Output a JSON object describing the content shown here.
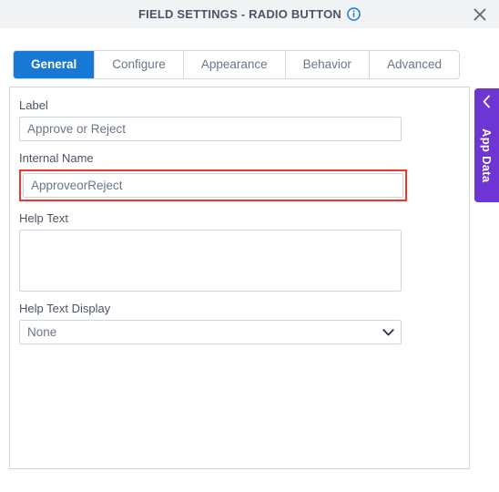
{
  "window": {
    "title": "FIELD SETTINGS - RADIO BUTTON",
    "info_icon": "info-circle-icon",
    "close_icon": "close-icon",
    "header_bg": "#f2f3f5",
    "title_color": "#4b5565"
  },
  "tabs": [
    {
      "label": "General",
      "active": true
    },
    {
      "label": "Configure",
      "active": false
    },
    {
      "label": "Appearance",
      "active": false
    },
    {
      "label": "Behavior",
      "active": false
    },
    {
      "label": "Advanced",
      "active": false
    }
  ],
  "accent": {
    "tab_active_bg": "#1779d3",
    "highlight_border": "#f4372a",
    "app_data_bg": "#6c35d4"
  },
  "form": {
    "label_field": {
      "label": "Label",
      "value": "Approve or Reject",
      "placeholder": ""
    },
    "internal_name_field": {
      "label": "Internal Name",
      "value": "ApproveorReject",
      "placeholder": "",
      "highlighted": true
    },
    "help_text_field": {
      "label": "Help Text",
      "value": "",
      "placeholder": ""
    },
    "help_text_display_field": {
      "label": "Help Text Display",
      "value": "None",
      "options": [
        "None"
      ],
      "chevron_icon": "chevron-down-icon"
    }
  },
  "app_data_panel": {
    "label": "App Data",
    "collapse_icon": "chevron-left-icon"
  }
}
